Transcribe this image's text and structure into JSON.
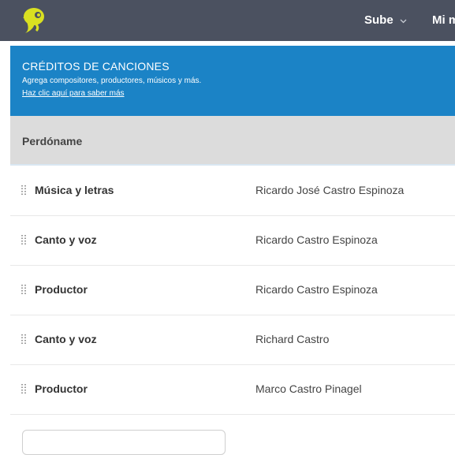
{
  "nav": {
    "logo_icon": "yellow-mascot-logo",
    "upload_label": "Sube",
    "account_label": "Mi m"
  },
  "banner": {
    "title": "CRÉDITOS DE CANCIONES",
    "subtitle": "Agrega compositores, productores, músicos y más.",
    "link": "Haz clic aquí para saber más",
    "color": "#1b83c6"
  },
  "song": {
    "title": "Perdóname"
  },
  "credits": [
    {
      "role": "Música y letras",
      "person": "Ricardo José Castro Espinoza"
    },
    {
      "role": "Canto y voz",
      "person": "Ricardo Castro Espinoza"
    },
    {
      "role": "Productor",
      "person": "Ricardo Castro Espinoza"
    },
    {
      "role": "Canto y voz",
      "person": "Richard Castro"
    },
    {
      "role": "Productor",
      "person": "Marco Castro Pinagel"
    }
  ]
}
